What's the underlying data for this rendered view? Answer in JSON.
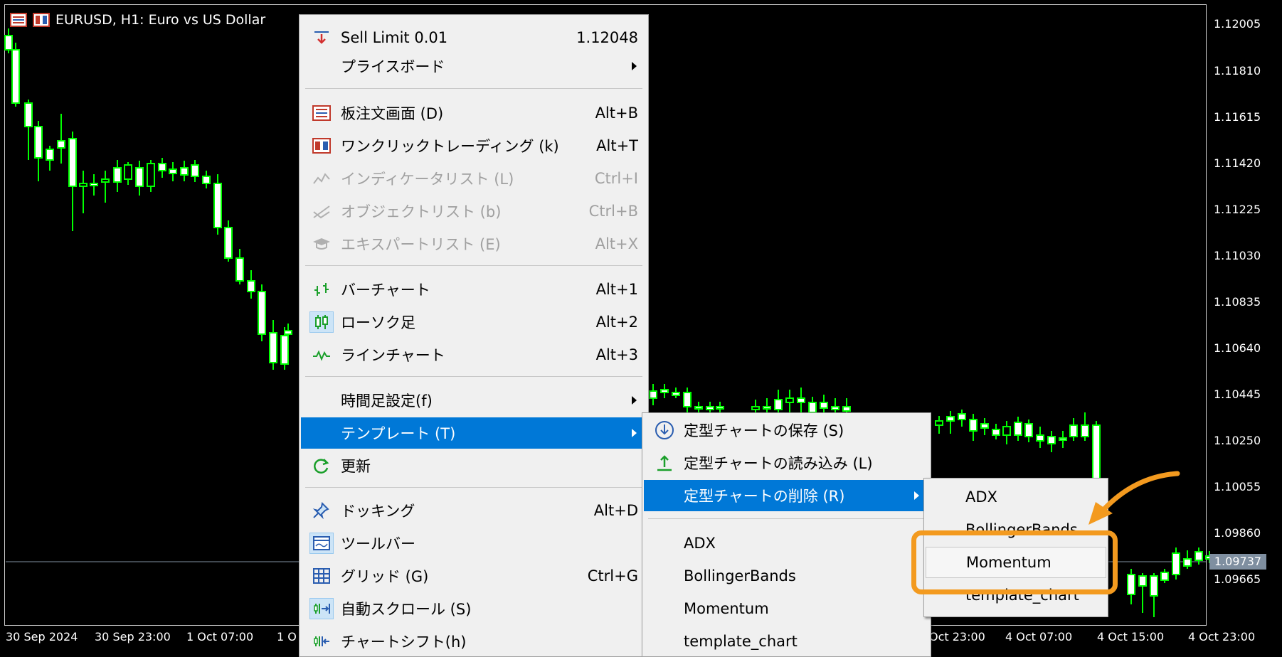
{
  "chart": {
    "symbol_title": "EURUSD, H1:  Euro vs US Dollar",
    "current_price": "1.09737",
    "price_axis": [
      "1.12005",
      "1.11810",
      "1.11615",
      "1.11420",
      "1.11225",
      "1.11030",
      "1.10835",
      "1.10640",
      "1.10445",
      "1.10250",
      "1.10055",
      "1.09860",
      "1.09665"
    ],
    "time_axis": [
      "30 Sep 2024",
      "30 Sep 23:00",
      "1 Oct 07:00",
      "1 O",
      "Oct 23:00",
      "4 Oct 07:00",
      "4 Oct 15:00",
      "4 Oct 23:00"
    ],
    "colors": {
      "background": "#000000",
      "candle": "#00ff00",
      "bull_body": "#000000",
      "bear_body": "#ffffff",
      "price_line": "#7f8fa0"
    }
  },
  "context_menu": {
    "items": [
      {
        "label": "Sell Limit 0.01",
        "shortcut": "1.12048",
        "icon": "sell-limit-icon"
      },
      {
        "label": "プライスボード",
        "submenu": true
      },
      {
        "label": "板注文画面 (D)",
        "shortcut": "Alt+B",
        "icon": "depth-of-market-icon"
      },
      {
        "label": "ワンクリックトレーディング (k)",
        "shortcut": "Alt+T",
        "icon": "one-click-trading-icon"
      },
      {
        "label": "インディケータリスト (L)",
        "shortcut": "Ctrl+I",
        "icon": "indicator-list-icon",
        "disabled": true
      },
      {
        "label": "オブジェクトリスト (b)",
        "shortcut": "Ctrl+B",
        "icon": "object-list-icon",
        "disabled": true
      },
      {
        "label": "エキスパートリスト (E)",
        "shortcut": "Alt+X",
        "icon": "expert-list-icon",
        "disabled": true
      },
      {
        "label": "バーチャート",
        "shortcut": "Alt+1",
        "icon": "bar-chart-icon"
      },
      {
        "label": "ローソク足",
        "shortcut": "Alt+2",
        "icon": "candlestick-icon"
      },
      {
        "label": "ラインチャート",
        "shortcut": "Alt+3",
        "icon": "line-chart-icon"
      },
      {
        "label": "時間足設定(f)",
        "submenu": true
      },
      {
        "label": "テンプレート (T)",
        "submenu": true,
        "highlighted": true
      },
      {
        "label": "更新",
        "icon": "refresh-icon"
      },
      {
        "label": "ドッキング",
        "shortcut": "Alt+D",
        "icon": "pin-icon"
      },
      {
        "label": "ツールバー",
        "icon": "toolbar-icon"
      },
      {
        "label": "グリッド (G)",
        "shortcut": "Ctrl+G",
        "icon": "grid-icon"
      },
      {
        "label": "自動スクロール (S)",
        "icon": "auto-scroll-icon"
      },
      {
        "label": "チャートシフト(h)",
        "icon": "chart-shift-icon"
      }
    ]
  },
  "template_submenu": {
    "items": [
      {
        "label": "定型チャートの保存 (S)",
        "icon": "save-template-icon"
      },
      {
        "label": "定型チャートの読み込み (L)",
        "icon": "load-template-icon"
      },
      {
        "label": "定型チャートの削除 (R)",
        "submenu": true,
        "highlighted": true
      },
      {
        "label": "ADX"
      },
      {
        "label": "BollingerBands"
      },
      {
        "label": "Momentum"
      },
      {
        "label": "template_chart"
      }
    ]
  },
  "delete_submenu": {
    "items": [
      {
        "label": "ADX"
      },
      {
        "label": "BollingerBands"
      },
      {
        "label": "Momentum",
        "selected": true
      },
      {
        "label": "template_chart"
      }
    ]
  },
  "annotation": {
    "color": "#f39a1f"
  }
}
